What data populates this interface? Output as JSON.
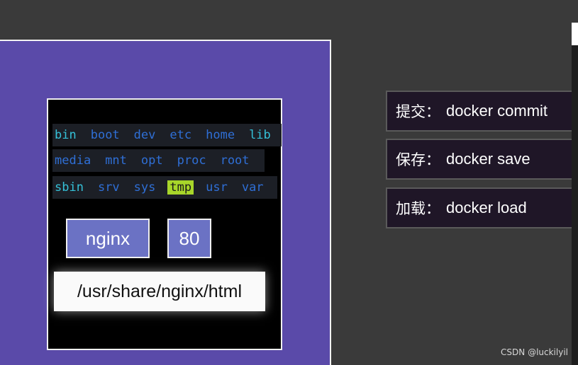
{
  "filesystem": {
    "rows": [
      [
        {
          "name": "bin",
          "color": "cyan"
        },
        {
          "name": "boot",
          "color": "blue"
        },
        {
          "name": "dev",
          "color": "blue"
        },
        {
          "name": "etc",
          "color": "blue"
        },
        {
          "name": "home",
          "color": "blue"
        },
        {
          "name": "lib",
          "color": "cyan"
        }
      ],
      [
        {
          "name": "media",
          "color": "blue"
        },
        {
          "name": "mnt",
          "color": "blue"
        },
        {
          "name": "opt",
          "color": "blue"
        },
        {
          "name": "proc",
          "color": "blue"
        },
        {
          "name": "root",
          "color": "blue"
        }
      ],
      [
        {
          "name": "sbin",
          "color": "cyan"
        },
        {
          "name": "srv",
          "color": "blue"
        },
        {
          "name": "sys",
          "color": "blue"
        },
        {
          "name": "tmp",
          "color": "highlight"
        },
        {
          "name": "usr",
          "color": "blue"
        },
        {
          "name": "var",
          "color": "blue"
        }
      ]
    ]
  },
  "container": {
    "name_label": "nginx",
    "port_label": "80",
    "path_label": "/usr/share/nginx/html"
  },
  "commands": [
    {
      "label": "提交",
      "sep": "：",
      "command": "docker commit"
    },
    {
      "label": "保存",
      "sep": "：",
      "command": "docker save"
    },
    {
      "label": "加载",
      "sep": "：",
      "command": "docker load"
    }
  ],
  "watermark": "CSDN @luckilyil",
  "colors": {
    "panel_purple": "#5a4aa9",
    "cyan_dir": "#35c1d8",
    "blue_dir": "#2f6fd6",
    "highlight": "#a8d62a",
    "tag_fill": "#6b72c4",
    "cmd_box": "#1f1627"
  }
}
